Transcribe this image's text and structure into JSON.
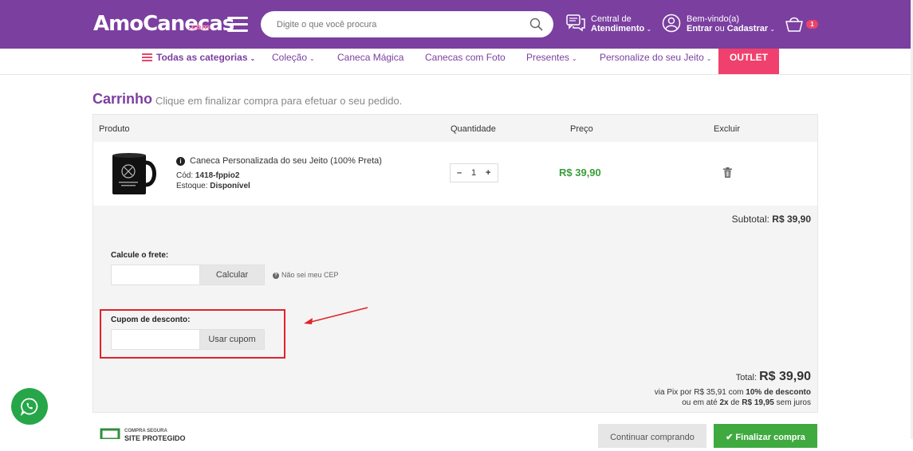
{
  "header": {
    "logo_text": "AmoCanecas",
    "logo_suffix": ".com",
    "search_placeholder": "Digite o que você procura",
    "support_line1": "Central de",
    "support_line2": "Atendimento",
    "welcome_line1": "Bem-vindo(a)",
    "welcome_login": "Entrar",
    "welcome_or": " ou ",
    "welcome_register": "Cadastrar",
    "cart_count": "1"
  },
  "nav": {
    "all_categories": "Todas as categorias",
    "items": [
      "Coleção",
      "Caneca Mágica",
      "Canecas com Foto",
      "Presentes",
      "Personalize do seu Jeito"
    ],
    "outlet": "OUTLET"
  },
  "page": {
    "title": "Carrinho",
    "subtitle": "Clique em finalizar compra para efetuar o seu pedido."
  },
  "cart": {
    "headers": {
      "product": "Produto",
      "quantity": "Quantidade",
      "price": "Preço",
      "remove": "Excluir"
    },
    "item": {
      "name": "Caneca Personalizada do seu Jeito (100% Preta)",
      "code_label": "Cód: ",
      "code": "1418-fppio2",
      "stock_label": "Estoque: ",
      "stock": "Disponível",
      "quantity": "1",
      "price": "R$ 39,90"
    },
    "subtotal_label": "Subtotal: ",
    "subtotal": "R$ 39,90",
    "shipping_label": "Calcule o frete:",
    "shipping_button": "Calcular",
    "cep_help": "Não sei meu CEP",
    "coupon_label": "Cupom de desconto:",
    "coupon_button": "Usar cupom",
    "total_label": "Total: ",
    "total": "R$ 39,90",
    "pix_prefix": "via Pix por ",
    "pix_value": "R$ 35,91",
    "pix_mid": " com ",
    "pix_discount": "10% de desconto",
    "installments_prefix": "ou em até ",
    "installments_count": "2x",
    "installments_mid": " de ",
    "installments_value": "R$ 19,95",
    "installments_suffix": " sem juros"
  },
  "footer": {
    "secure_top": "COMPRA SEGURA",
    "secure_bottom": "SITE PROTEGIDO",
    "continue_button": "Continuar comprando",
    "finish_button": "Finalizar compra"
  },
  "colors": {
    "brand_purple": "#7b3fa0",
    "outlet_pink": "#f0416e",
    "price_green": "#3a9d3a",
    "highlight_red": "#e0232a",
    "whatsapp_green": "#26a648"
  }
}
